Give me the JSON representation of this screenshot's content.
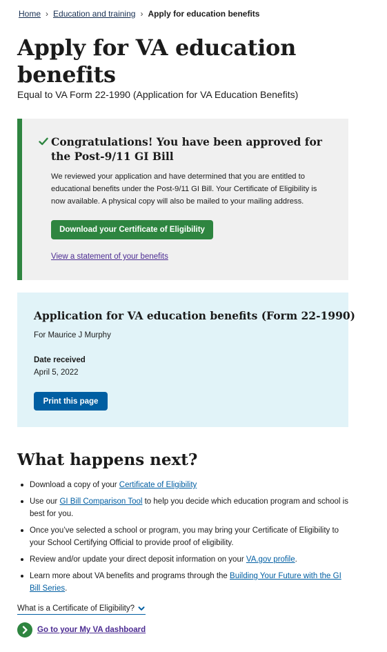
{
  "breadcrumb": {
    "items": [
      "Home",
      "Education and training"
    ],
    "current": "Apply for education benefits"
  },
  "page": {
    "title": "Apply for VA education benefits",
    "subtitle": "Equal to VA Form 22-1990 (Application for VA Education Benefits)"
  },
  "alert": {
    "heading": "Congratulations! You have been approved for the Post-9/11 GI Bill",
    "body": "We reviewed your application and have determined that you are entitled to educational benefits under the Post-9/11 GI Bill. Your Certificate of Eligibility is now available. A physical copy will also be mailed to your mailing address.",
    "download_label": "Download your Certificate of Eligibility",
    "statement_link": "View a statement of your benefits",
    "accent_color": "#2e8540"
  },
  "summary": {
    "title": "Application for VA education benefits (Form 22-1990)",
    "for_text": "For Maurice J Murphy",
    "date_label": "Date received",
    "date_value": "April 5, 2022",
    "print_label": "Print this page"
  },
  "next": {
    "title": "What happens next?",
    "items": [
      {
        "before": "Download a copy of your ",
        "link": "Certificate of Eligibility",
        "after": ""
      },
      {
        "before": "Use our ",
        "link": "GI Bill Comparison Tool",
        "after": " to help you decide which education program and school is best for you."
      },
      {
        "before": "Once you’ve selected a school or program, you may bring your Certificate of Eligibility to your School Certifying Official to provide proof of eligibility.",
        "link": "",
        "after": ""
      },
      {
        "before": "Review and/or update your direct deposit information on your ",
        "link": "VA.gov profile",
        "after": "."
      },
      {
        "before": "Learn more about VA benefits and programs through the ",
        "link": "Building Your Future with the GI Bill Series",
        "after": "."
      }
    ]
  },
  "expander": {
    "label": "What is a Certificate of Eligibility?"
  },
  "dashboard": {
    "link": "Go to your My VA dashboard"
  },
  "icons": {
    "check": "check-icon",
    "chevron": "chevron-down-icon",
    "arrow": "arrow-right-circle-icon"
  },
  "colors": {
    "primary": "#005ea2",
    "success": "#2e8540",
    "info_bg": "#e1f3f8",
    "gray_bg": "#f0f0f0",
    "visited_link": "#4c2c92"
  }
}
